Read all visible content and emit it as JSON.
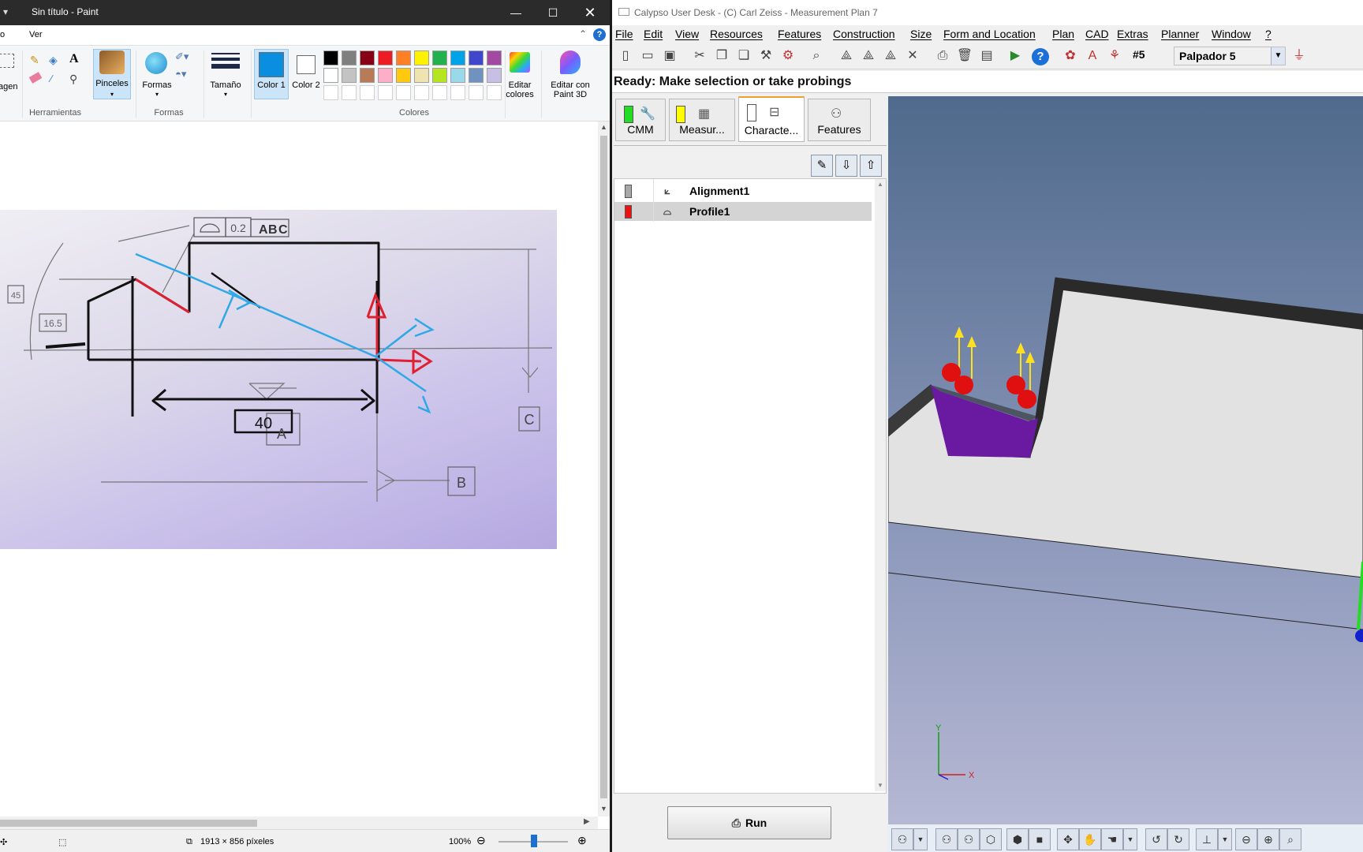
{
  "paint": {
    "title": "Sin título - Paint",
    "menu": [
      "o",
      "Ver"
    ],
    "ribbon": {
      "imagen": "agen",
      "herramientas_label": "Herramientas",
      "pinceles": "Pinceles",
      "formas_btn": "Formas",
      "formas_group": "Formas",
      "tamano": "Tamaño",
      "color1": "Color 1",
      "color2": "Color 2",
      "colores_group": "Colores",
      "editar_colores": "Editar colores",
      "editar_paint3d": "Editar con Paint 3D"
    },
    "palette_row1": [
      "#000000",
      "#7f7f7f",
      "#880015",
      "#ed1c24",
      "#ff7f27",
      "#fff200",
      "#22b14c",
      "#00a2e8",
      "#3f48cc",
      "#a349a4"
    ],
    "palette_row2": [
      "#ffffff",
      "#c3c3c3",
      "#b97a57",
      "#ffaec9",
      "#ffc90e",
      "#efe4b0",
      "#b5e61d",
      "#99d9ea",
      "#7092be",
      "#c8bfe7"
    ],
    "color1_value": "#0a8ee0",
    "drawing": {
      "gdt_value": "0.2",
      "gdt_datums": [
        "A",
        "B",
        "C"
      ],
      "dim_left": "16.5",
      "dim_side": "45",
      "dim_bottom": "40",
      "datum_a": "A",
      "datum_b": "B",
      "datum_c": "C"
    },
    "status": {
      "image_size": "1913 × 856 píxeles",
      "zoom": "100%"
    }
  },
  "calypso": {
    "title": "Calypso User Desk - (C) Carl Zeiss - Measurement Plan 7",
    "menu": [
      "File",
      "Edit",
      "View",
      "Resources",
      "Features",
      "Construction",
      "Size",
      "Form and Location",
      "Plan",
      "CAD",
      "Extras",
      "Planner",
      "Window",
      "?"
    ],
    "probe_number": "#5",
    "probe_name": "Palpador 5",
    "status_text": "Ready: Make selection or take probings",
    "tabs": [
      {
        "label": "CMM",
        "color": "#22dd22"
      },
      {
        "label": "Measur...",
        "color": "#ffff00"
      },
      {
        "label": "Characte...",
        "color": "#ffffff"
      },
      {
        "label": "Features",
        "color": ""
      }
    ],
    "tree": [
      {
        "name": "Alignment1",
        "color": "#a8a8a8"
      },
      {
        "name": "Profile1",
        "color": "#ee1111"
      }
    ],
    "run_label": "Run",
    "axis_x": "X",
    "axis_y": "Y"
  }
}
